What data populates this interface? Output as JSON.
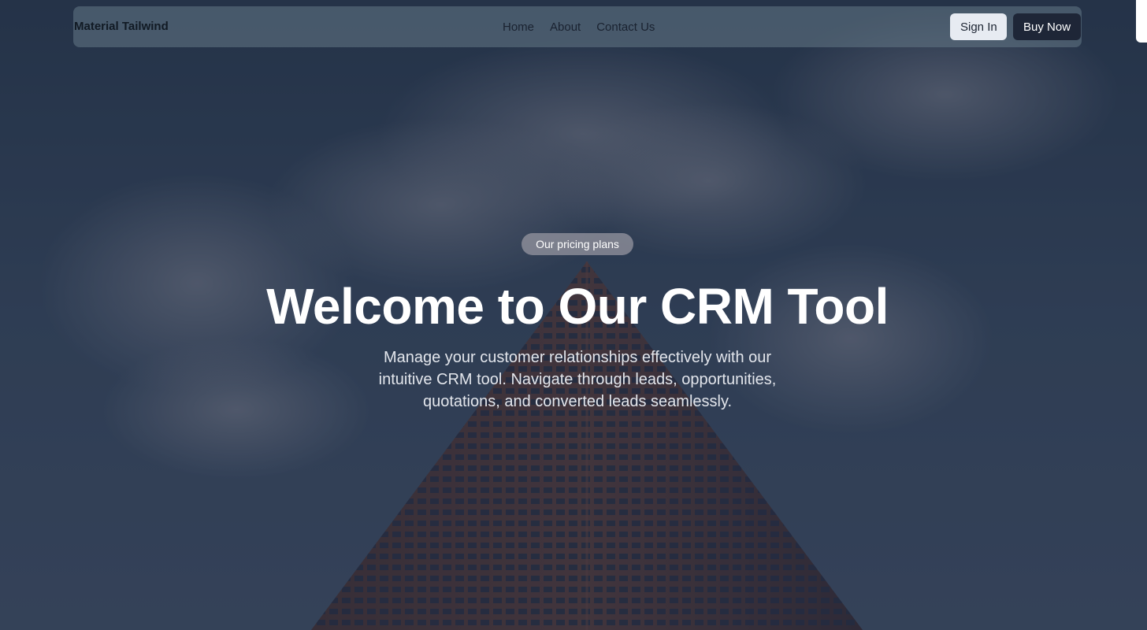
{
  "navbar": {
    "brand": "Material Tailwind",
    "links": [
      {
        "label": "Home"
      },
      {
        "label": "About"
      },
      {
        "label": "Contact Us"
      }
    ],
    "sign_in_label": "Sign In",
    "buy_now_label": "Buy Now"
  },
  "hero": {
    "badge": "Our pricing plans",
    "title": "Welcome to Our CRM Tool",
    "subtitle": "Manage your customer relationships effectively with our intuitive CRM tool. Navigate through leads, opportunities, quotations, and converted leads seamlessly."
  },
  "colors": {
    "nav_background": "#647887",
    "buy_now_button": "#1e2637",
    "sign_in_button": "#e7ebf2",
    "badge_background": "#96969f"
  }
}
